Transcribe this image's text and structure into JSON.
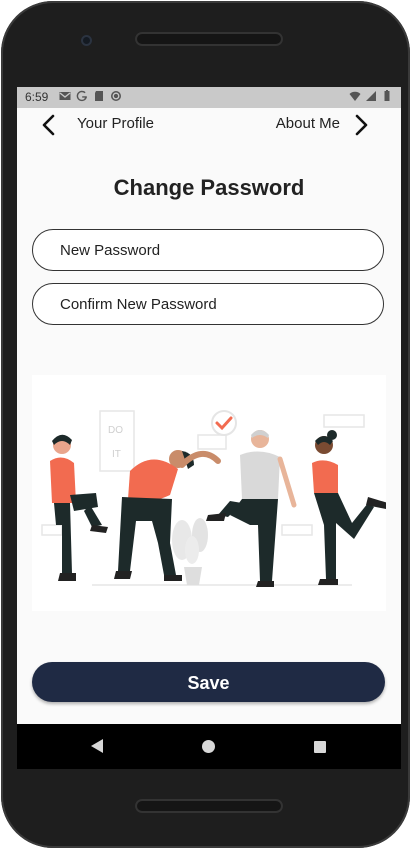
{
  "status_bar": {
    "time": "6:59",
    "left_icons": [
      "gmail-icon",
      "google-icon",
      "sd-card-icon",
      "sync-icon"
    ],
    "right_icons": [
      "wifi-icon",
      "signal-icon",
      "battery-icon"
    ]
  },
  "nav": {
    "back_label": "Your Profile",
    "forward_label": "About Me"
  },
  "page": {
    "title": "Change Password"
  },
  "form": {
    "new_password_placeholder": "New Password",
    "confirm_password_placeholder": "Confirm New Password",
    "save_label": "Save"
  },
  "illustration": {
    "sign_text_1": "DO",
    "sign_text_2": "IT"
  },
  "colors": {
    "accent": "#f26b50",
    "button": "#1f2a44",
    "dark_figure": "#1d2a2a",
    "screen_bg": "#fafafa"
  }
}
